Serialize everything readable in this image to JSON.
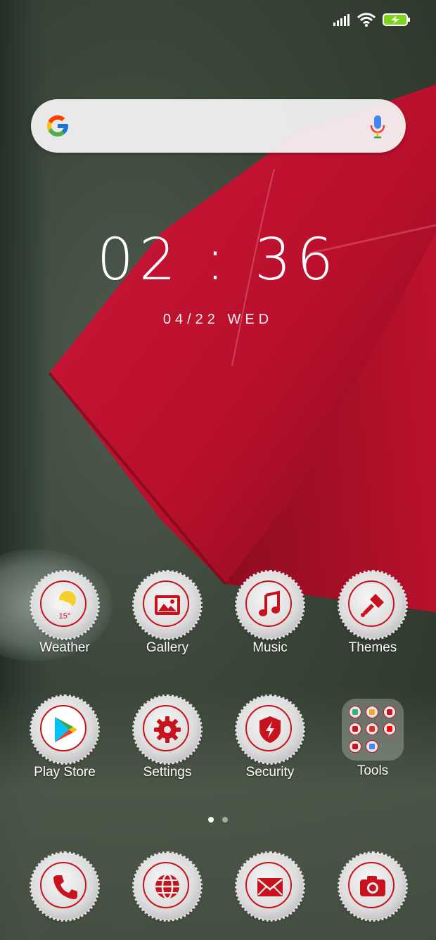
{
  "status_bar": {
    "signal_icon": "signal-bars-icon",
    "wifi_icon": "wifi-icon",
    "battery_icon": "battery-charging-icon"
  },
  "search": {
    "logo_icon": "google-g-icon",
    "mic_icon": "microphone-icon"
  },
  "clock": {
    "time": "02 : 36",
    "date": "04/22 WED"
  },
  "apps_row1": [
    {
      "label": "Weather",
      "icon": "weather-sun-cloud-icon",
      "temp": "15°"
    },
    {
      "label": "Gallery",
      "icon": "gallery-image-icon"
    },
    {
      "label": "Music",
      "icon": "music-note-icon"
    },
    {
      "label": "Themes",
      "icon": "paintbrush-icon"
    }
  ],
  "apps_row2": [
    {
      "label": "Play Store",
      "icon": "play-store-icon"
    },
    {
      "label": "Settings",
      "icon": "gear-icon"
    },
    {
      "label": "Security",
      "icon": "shield-bolt-icon"
    },
    {
      "label": "Tools",
      "icon": "folder-icon"
    }
  ],
  "page_indicator": {
    "total": 2,
    "current": 1
  },
  "dock": [
    {
      "name": "Phone",
      "icon": "phone-icon"
    },
    {
      "name": "Browser",
      "icon": "globe-icon"
    },
    {
      "name": "Messages",
      "icon": "envelope-icon"
    },
    {
      "name": "Camera",
      "icon": "camera-icon"
    }
  ],
  "colors": {
    "accent": "#c8121e",
    "umbrella": "#c4122f",
    "search_bg": "#f5f5f5"
  }
}
